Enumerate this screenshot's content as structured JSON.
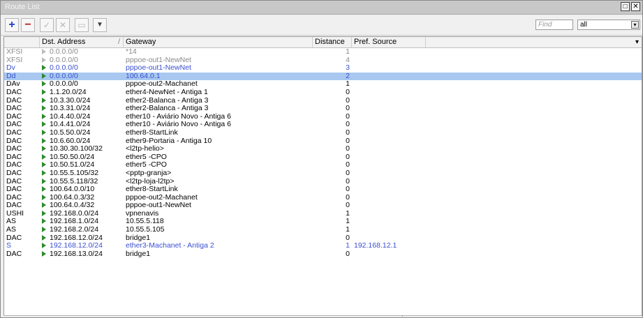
{
  "window": {
    "title": "Route List",
    "restore_label": "□",
    "close_label": "✕"
  },
  "toolbar": {
    "add_label": "+",
    "remove_label": "−",
    "enable_label": "✓",
    "disable_label": "✕",
    "comment_label": "▭",
    "filter_label": "▼",
    "find_placeholder": "Find",
    "filter_value": "all",
    "filter_arrow": "▾"
  },
  "table": {
    "headers": [
      "",
      "Dst. Address",
      "Gateway",
      "Distance",
      "Pref. Source"
    ],
    "sort_indicator": "/",
    "more_columns_label": "▾",
    "rows": [
      {
        "flags": "XFSI",
        "dst": "0.0.0.0/0",
        "gateway": "*14",
        "distance": "1",
        "pref_source": "",
        "style": "gray"
      },
      {
        "flags": "XFSI",
        "dst": "0.0.0.0/0",
        "gateway": "pppoe-out1-NewNet",
        "distance": "4",
        "pref_source": "",
        "style": "gray"
      },
      {
        "flags": "Dv",
        "dst": "0.0.0.0/0",
        "gateway": "pppoe-out1-NewNet",
        "distance": "3",
        "pref_source": "",
        "style": "blue"
      },
      {
        "flags": "Dd",
        "dst": "0.0.0.0/0",
        "gateway": "100.64.0.1",
        "distance": "2",
        "pref_source": "",
        "style": "blue selected"
      },
      {
        "flags": "DAv",
        "dst": "0.0.0.0/0",
        "gateway": "pppoe-out2-Machanet",
        "distance": "1",
        "pref_source": "",
        "style": ""
      },
      {
        "flags": "DAC",
        "dst": "1.1.20.0/24",
        "gateway": "ether4-NewNet -  Antiga 1",
        "distance": "0",
        "pref_source": "",
        "style": ""
      },
      {
        "flags": "DAC",
        "dst": "10.3.30.0/24",
        "gateway": "ether2-Balanca - Antiga 3",
        "distance": "0",
        "pref_source": "",
        "style": ""
      },
      {
        "flags": "DAC",
        "dst": "10.3.31.0/24",
        "gateway": "ether2-Balanca - Antiga 3",
        "distance": "0",
        "pref_source": "",
        "style": ""
      },
      {
        "flags": "DAC",
        "dst": "10.4.40.0/24",
        "gateway": "ether10 - Aviário Novo - Antiga 6",
        "distance": "0",
        "pref_source": "",
        "style": ""
      },
      {
        "flags": "DAC",
        "dst": "10.4.41.0/24",
        "gateway": "ether10 - Aviário Novo - Antiga 6",
        "distance": "0",
        "pref_source": "",
        "style": ""
      },
      {
        "flags": "DAC",
        "dst": "10.5.50.0/24",
        "gateway": "ether8-StartLink",
        "distance": "0",
        "pref_source": "",
        "style": ""
      },
      {
        "flags": "DAC",
        "dst": "10.6.60.0/24",
        "gateway": "ether9-Portaria - Antiga 10",
        "distance": "0",
        "pref_source": "",
        "style": ""
      },
      {
        "flags": "DAC",
        "dst": "10.30.30.100/32",
        "gateway": "<l2tp-helio>",
        "distance": "0",
        "pref_source": "",
        "style": ""
      },
      {
        "flags": "DAC",
        "dst": "10.50.50.0/24",
        "gateway": "ether5 -CPO",
        "distance": "0",
        "pref_source": "",
        "style": ""
      },
      {
        "flags": "DAC",
        "dst": "10.50.51.0/24",
        "gateway": "ether5 -CPO",
        "distance": "0",
        "pref_source": "",
        "style": ""
      },
      {
        "flags": "DAC",
        "dst": "10.55.5.105/32",
        "gateway": "<pptp-granja>",
        "distance": "0",
        "pref_source": "",
        "style": ""
      },
      {
        "flags": "DAC",
        "dst": "10.55.5.118/32",
        "gateway": "<l2tp-loja-l2tp>",
        "distance": "0",
        "pref_source": "",
        "style": ""
      },
      {
        "flags": "DAC",
        "dst": "100.64.0.0/10",
        "gateway": "ether8-StartLink",
        "distance": "0",
        "pref_source": "",
        "style": ""
      },
      {
        "flags": "DAC",
        "dst": "100.64.0.3/32",
        "gateway": "pppoe-out2-Machanet",
        "distance": "0",
        "pref_source": "",
        "style": ""
      },
      {
        "flags": "DAC",
        "dst": "100.64.0.4/32",
        "gateway": "pppoe-out1-NewNet",
        "distance": "0",
        "pref_source": "",
        "style": ""
      },
      {
        "flags": "USHI",
        "dst": "192.168.0.0/24",
        "gateway": "vpnenavis",
        "distance": "1",
        "pref_source": "",
        "style": ""
      },
      {
        "flags": "AS",
        "dst": "192.168.1.0/24",
        "gateway": "10.55.5.118",
        "distance": "1",
        "pref_source": "",
        "style": ""
      },
      {
        "flags": "AS",
        "dst": "192.168.2.0/24",
        "gateway": "10.55.5.105",
        "distance": "1",
        "pref_source": "",
        "style": ""
      },
      {
        "flags": "DAC",
        "dst": "192.168.12.0/24",
        "gateway": "bridge1",
        "distance": "0",
        "pref_source": "",
        "style": ""
      },
      {
        "flags": "S",
        "dst": "192.168.12.0/24",
        "gateway": "ether3-Machanet - Antiga 2",
        "distance": "1",
        "pref_source": "192.168.12.1",
        "style": "blue"
      },
      {
        "flags": "DAC",
        "dst": "192.168.13.0/24",
        "gateway": "bridge1",
        "distance": "0",
        "pref_source": "",
        "style": ""
      }
    ]
  }
}
